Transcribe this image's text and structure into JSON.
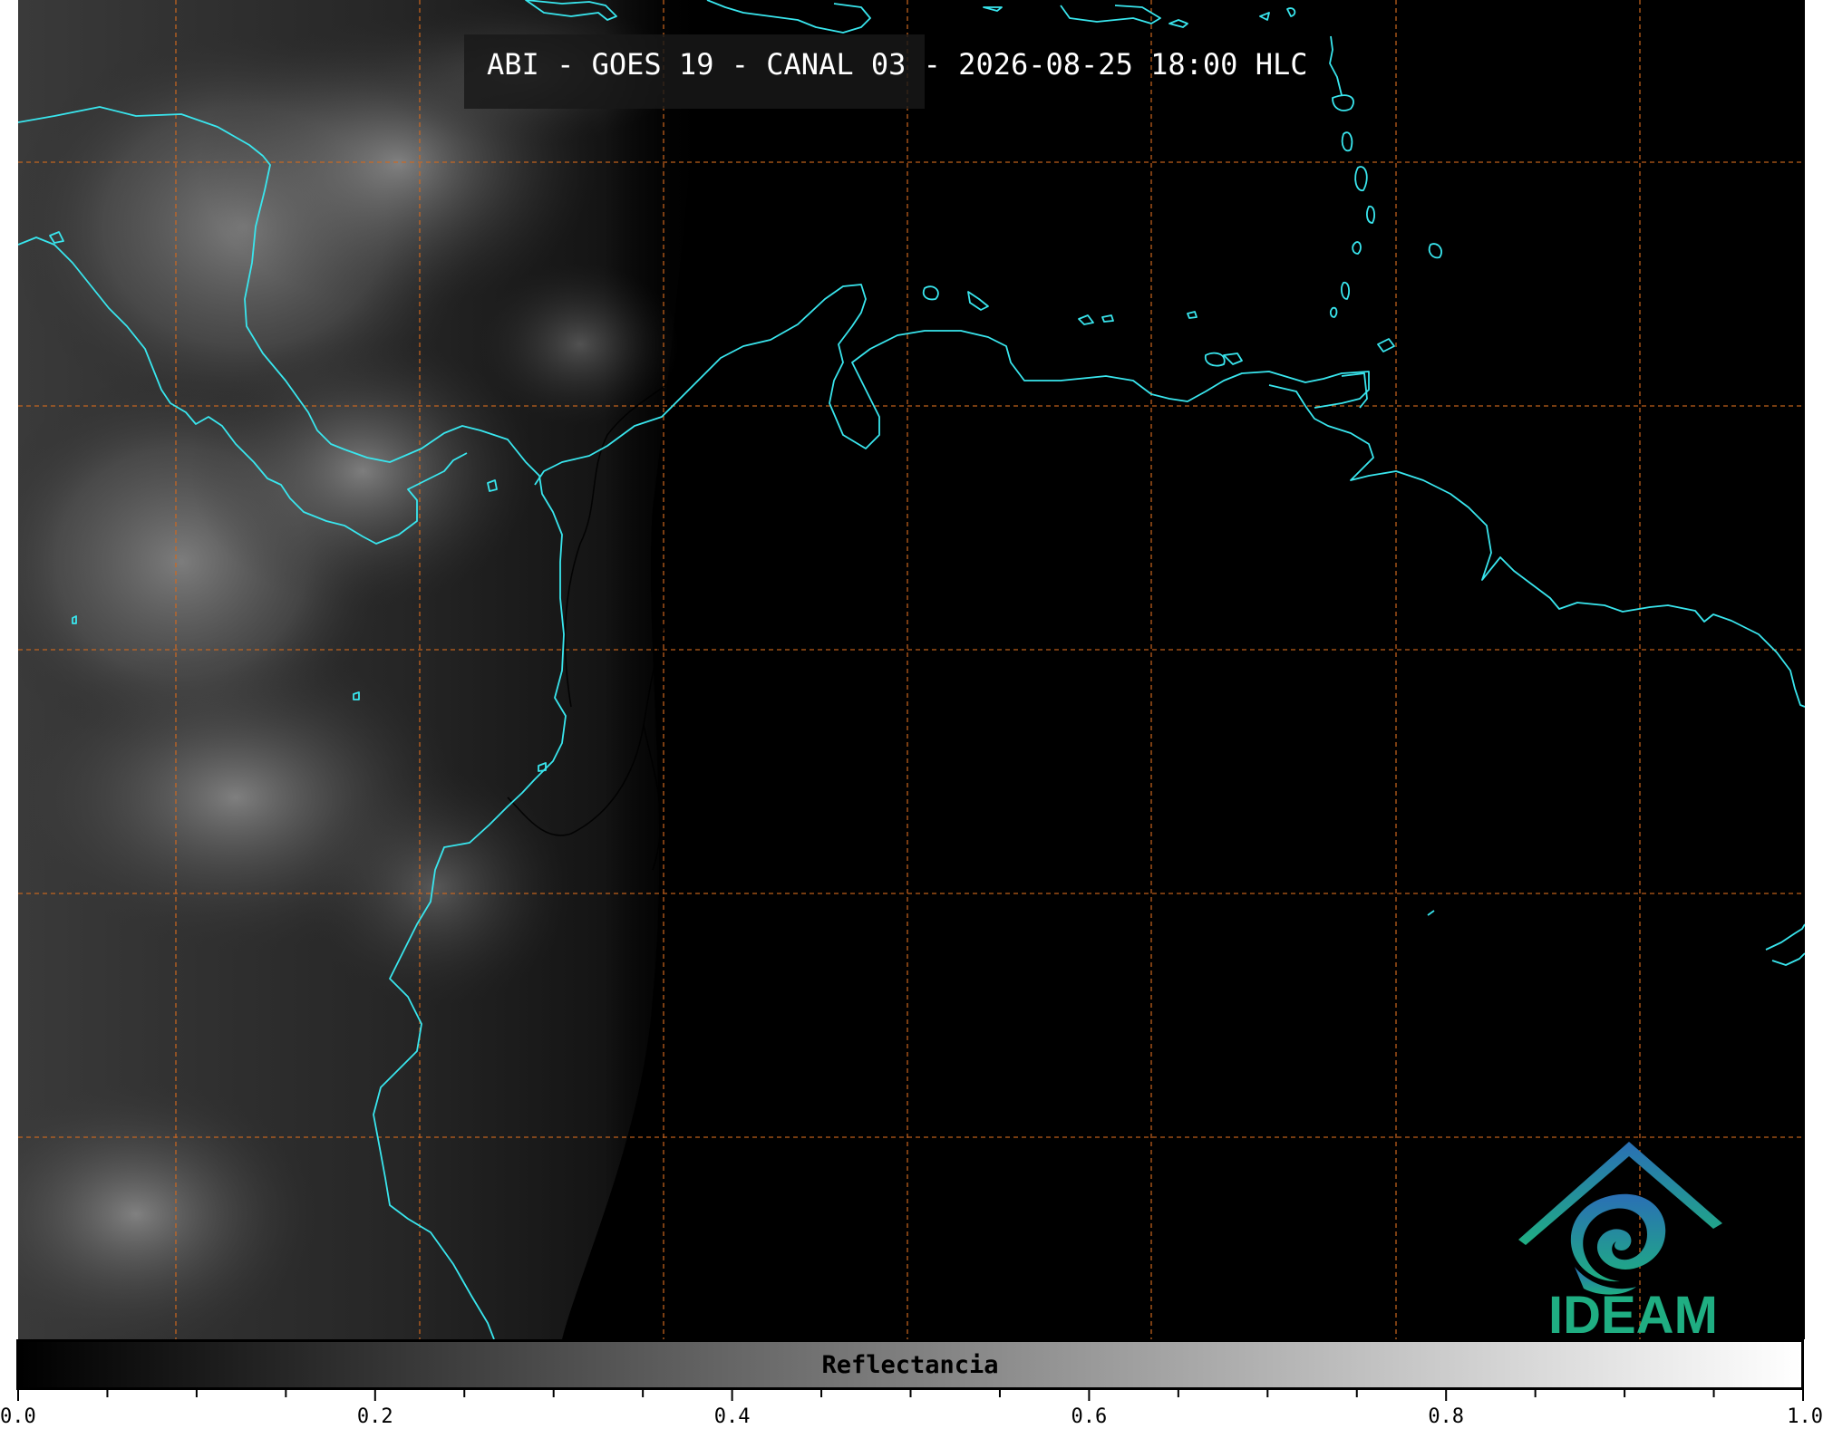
{
  "title": "ABI - GOES 19 - CANAL 03 - 2026-08-25 18:00 HLC",
  "logo": {
    "text": "IDEAM",
    "icon": "ideam-logo-icon"
  },
  "colorbar": {
    "label": "Reflectancia",
    "min": 0.0,
    "max": 1.0,
    "labels": [
      "0.0",
      "0.2",
      "0.4",
      "0.6",
      "0.8",
      "1.0"
    ],
    "minor_step": 0.05
  },
  "colors": {
    "coastline": "#39e6ee",
    "gridline": "#d2691e",
    "background": "#000000",
    "logo_teal": "#1fae82",
    "logo_blue": "#2a6fb5"
  }
}
